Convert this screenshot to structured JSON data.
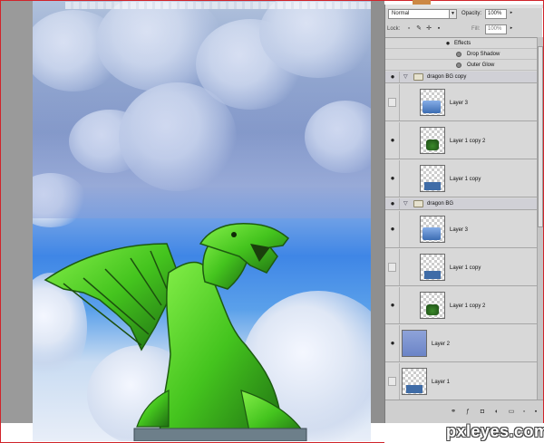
{
  "panel": {
    "blend_mode": "Normal",
    "opacity_label": "Opacity:",
    "opacity_value": "100%",
    "lock_label": "Lock:",
    "fill_label": "Fill:",
    "fill_value": "100%"
  },
  "layers": {
    "effects_label": "Effects",
    "drop_shadow": "Drop Shadow",
    "outer_glow": "Outer Glow",
    "group1": "dragon BG copy",
    "g1_layer3": "Layer 3",
    "g1_layer1copy2": "Layer 1 copy 2",
    "g1_layer1copy": "Layer 1 copy",
    "group2": "dragon BG",
    "g2_layer3": "Layer 3",
    "g2_layer1copy": "Layer 1 copy",
    "g2_layer1copy2": "Layer 1 copy 2",
    "layer2": "Layer 2",
    "layer1": "Layer 1"
  },
  "watermark": "pxleyes.com",
  "colors": {
    "frame_border": "#d0242a",
    "panel_bg": "#d4d4d4",
    "dragon_green": "#4fd12a"
  },
  "icons": [
    "eye-icon",
    "folder-icon",
    "fx-icon",
    "lock-icon",
    "link-icon",
    "new-layer-icon",
    "trash-icon"
  ]
}
